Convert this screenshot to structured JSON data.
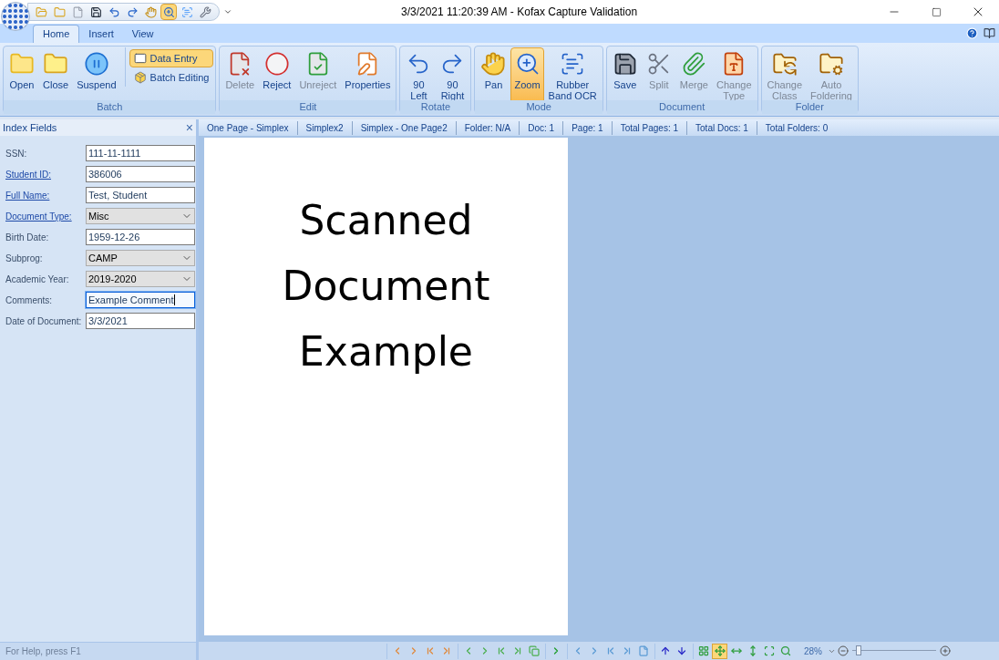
{
  "window": {
    "title": "3/3/2021 11:20:39 AM - Kofax Capture Validation"
  },
  "quick_access": [
    {
      "kind": "open",
      "selected": false
    },
    {
      "kind": "close",
      "selected": false
    },
    {
      "kind": "doc",
      "selected": false
    },
    {
      "kind": "save",
      "selected": false
    },
    {
      "kind": "undo",
      "selected": false
    },
    {
      "kind": "redo",
      "selected": false
    },
    {
      "kind": "pan",
      "selected": false
    },
    {
      "kind": "zoom",
      "selected": true
    },
    {
      "kind": "ocr",
      "selected": false
    },
    {
      "kind": "tools",
      "selected": false
    }
  ],
  "tabs": [
    {
      "label": "Home",
      "selected": true
    },
    {
      "label": "Insert",
      "selected": false
    },
    {
      "label": "View",
      "selected": false
    }
  ],
  "ribbon": [
    {
      "title": "Batch",
      "items": [
        {
          "kind": "open",
          "lines": [
            "Open"
          ],
          "disabled": false
        },
        {
          "kind": "close",
          "lines": [
            "Close"
          ],
          "disabled": false
        },
        {
          "kind": "suspend",
          "lines": [
            "Suspend"
          ],
          "disabled": false
        },
        {
          "kind": "entry",
          "lines": [
            "Data Entry"
          ],
          "disabled": false,
          "selected": true
        },
        {
          "kind": "batch",
          "lines": [
            "Batch Editing"
          ],
          "disabled": false,
          "selected": false
        }
      ]
    },
    {
      "title": "Edit",
      "items": [
        {
          "kind": "delete",
          "lines": [
            "Delete"
          ],
          "disabled": true
        },
        {
          "kind": "reject",
          "lines": [
            "Reject"
          ],
          "disabled": false
        },
        {
          "kind": "unreject",
          "lines": [
            "Unreject"
          ],
          "disabled": true
        },
        {
          "kind": "properties",
          "lines": [
            "Properties"
          ],
          "disabled": false
        }
      ]
    },
    {
      "title": "Rotate",
      "items": [
        {
          "kind": "left",
          "lines": [
            "90",
            "Left"
          ],
          "disabled": false
        },
        {
          "kind": "right",
          "lines": [
            "90",
            "Right"
          ],
          "disabled": false
        }
      ]
    },
    {
      "title": "Mode",
      "items": [
        {
          "kind": "pan",
          "lines": [
            "Pan"
          ],
          "disabled": false,
          "selected": false
        },
        {
          "kind": "zoom",
          "lines": [
            "Zoom"
          ],
          "disabled": false,
          "selected": true
        },
        {
          "kind": "ocr",
          "lines": [
            "Rubber",
            "Band OCR"
          ],
          "disabled": false,
          "selected": false
        }
      ]
    },
    {
      "title": "Document",
      "items": [
        {
          "kind": "save",
          "lines": [
            "Save"
          ],
          "disabled": false
        },
        {
          "kind": "split",
          "lines": [
            "Split"
          ],
          "disabled": true
        },
        {
          "kind": "merge",
          "lines": [
            "Merge"
          ],
          "disabled": true
        },
        {
          "kind": "changetype",
          "lines": [
            "Change",
            "Type"
          ],
          "disabled": true
        }
      ]
    },
    {
      "title": "Folder",
      "items": [
        {
          "kind": "changeclass",
          "lines": [
            "Change",
            "Class"
          ],
          "disabled": true
        },
        {
          "kind": "autofolder",
          "lines": [
            "Auto",
            "Foldering"
          ],
          "disabled": true
        }
      ]
    }
  ],
  "index_fields": {
    "title": "Index Fields",
    "close": "×",
    "fields": [
      {
        "label": "SSN:",
        "linked": false,
        "kind": "text",
        "value": "111-11-1111",
        "focused": false
      },
      {
        "label": "Student ID:",
        "linked": true,
        "kind": "text",
        "value": "386006",
        "focused": false
      },
      {
        "label": "Full Name:",
        "linked": true,
        "kind": "text",
        "value": "Test, Student",
        "focused": false
      },
      {
        "label": "Document Type:",
        "linked": true,
        "kind": "dropdown",
        "value": "Misc"
      },
      {
        "label": "Birth Date:",
        "linked": false,
        "kind": "text",
        "value": "1959-12-26",
        "focused": false
      },
      {
        "label": "Subprog:",
        "linked": false,
        "kind": "dropdown",
        "value": "CAMP"
      },
      {
        "label": "Academic Year:",
        "linked": false,
        "kind": "dropdown",
        "value": "2019-2020"
      },
      {
        "label": "Comments:",
        "linked": false,
        "kind": "text",
        "value": "Example Comment",
        "focused": true
      },
      {
        "label": "Date of Document:",
        "linked": false,
        "kind": "text",
        "value": "3/3/2021",
        "focused": false
      }
    ]
  },
  "info_bar": [
    "One Page - Simplex",
    "Simplex2",
    "Simplex - One Page2",
    "Folder: N/A",
    "Doc: 1",
    "Page: 1",
    "Total Pages: 1",
    "Total Docs: 1",
    "Total Folders: 0"
  ],
  "document": {
    "lines": [
      "Scanned",
      "Document",
      "Example"
    ]
  },
  "status_bar": {
    "help": "For Help, press F1",
    "nav_groups": [
      {
        "kind": "batch",
        "buttons": [
          {
            "kind": "prev",
            "selected": false
          },
          {
            "kind": "next",
            "selected": false
          },
          {
            "kind": "first",
            "selected": false
          },
          {
            "kind": "last",
            "selected": false
          }
        ]
      },
      {
        "kind": "doc",
        "buttons": [
          {
            "kind": "prev",
            "selected": false
          },
          {
            "kind": "next",
            "selected": false
          },
          {
            "kind": "first",
            "selected": false
          },
          {
            "kind": "last",
            "selected": false
          },
          {
            "kind": "pages",
            "selected": false
          }
        ]
      },
      {
        "kind": "go",
        "buttons": [
          {
            "kind": "next",
            "selected": false
          }
        ]
      },
      {
        "kind": "page",
        "buttons": [
          {
            "kind": "prev",
            "selected": false
          },
          {
            "kind": "next",
            "selected": false
          },
          {
            "kind": "first",
            "selected": false
          },
          {
            "kind": "last",
            "selected": false
          },
          {
            "kind": "sheet",
            "selected": false
          }
        ]
      },
      {
        "kind": "move",
        "buttons": [
          {
            "kind": "up",
            "selected": false
          },
          {
            "kind": "down",
            "selected": false
          }
        ]
      },
      {
        "kind": "view",
        "buttons": [
          {
            "kind": "thumbs",
            "selected": false
          },
          {
            "kind": "fit",
            "selected": true
          },
          {
            "kind": "width",
            "selected": false
          },
          {
            "kind": "height",
            "selected": false
          },
          {
            "kind": "actual",
            "selected": false
          },
          {
            "kind": "magnify",
            "selected": false
          }
        ]
      }
    ],
    "zoom": "28%",
    "zoom_level": {
      "level": 0.05
    }
  }
}
